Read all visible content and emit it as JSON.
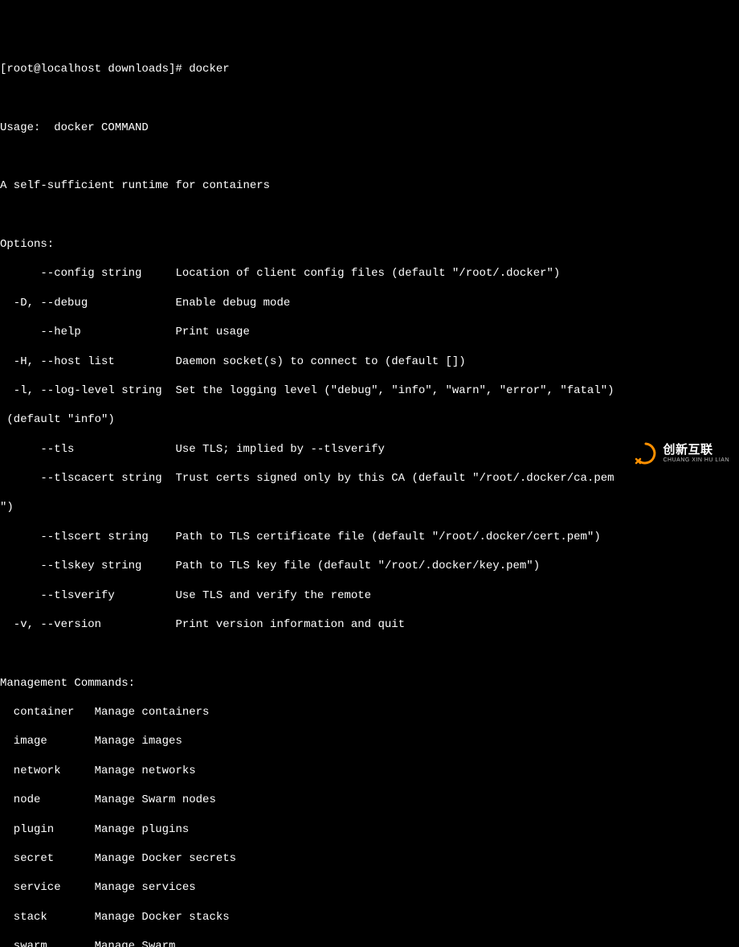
{
  "prompt": "[root@localhost downloads]# docker",
  "usage": "Usage:  docker COMMAND",
  "description": "A self-sufficient runtime for containers",
  "options_header": "Options:",
  "options": [
    {
      "flag": "      --config string     ",
      "desc": "Location of client config files (default \"/root/.docker\")"
    },
    {
      "flag": "  -D, --debug             ",
      "desc": "Enable debug mode"
    },
    {
      "flag": "      --help              ",
      "desc": "Print usage"
    },
    {
      "flag": "  -H, --host list         ",
      "desc": "Daemon socket(s) to connect to (default [])"
    },
    {
      "flag": "  -l, --log-level string  ",
      "desc": "Set the logging level (\"debug\", \"info\", \"warn\", \"error\", \"fatal\")"
    }
  ],
  "log_level_wrap": " (default \"info\")",
  "options2": [
    {
      "flag": "      --tls               ",
      "desc": "Use TLS; implied by --tlsverify"
    },
    {
      "flag": "      --tlscacert string  ",
      "desc": "Trust certs signed only by this CA (default \"/root/.docker/ca.pem"
    }
  ],
  "tlscacert_wrap": "\")",
  "options3": [
    {
      "flag": "      --tlscert string    ",
      "desc": "Path to TLS certificate file (default \"/root/.docker/cert.pem\")"
    },
    {
      "flag": "      --tlskey string     ",
      "desc": "Path to TLS key file (default \"/root/.docker/key.pem\")"
    },
    {
      "flag": "      --tlsverify         ",
      "desc": "Use TLS and verify the remote"
    },
    {
      "flag": "  -v, --version           ",
      "desc": "Print version information and quit"
    }
  ],
  "mgmt_header": "Management Commands:",
  "mgmt": [
    {
      "cmd": "  container   ",
      "desc": "Manage containers"
    },
    {
      "cmd": "  image       ",
      "desc": "Manage images"
    },
    {
      "cmd": "  network     ",
      "desc": "Manage networks"
    },
    {
      "cmd": "  node        ",
      "desc": "Manage Swarm nodes"
    },
    {
      "cmd": "  plugin      ",
      "desc": "Manage plugins"
    },
    {
      "cmd": "  secret      ",
      "desc": "Manage Docker secrets"
    },
    {
      "cmd": "  service     ",
      "desc": "Manage services"
    },
    {
      "cmd": "  stack       ",
      "desc": "Manage Docker stacks"
    },
    {
      "cmd": "  swarm       ",
      "desc": "Manage Swarm"
    }
  ],
  "watermark": {
    "cn": "创新互联",
    "en": "CHUANG XIN HU LIAN"
  }
}
